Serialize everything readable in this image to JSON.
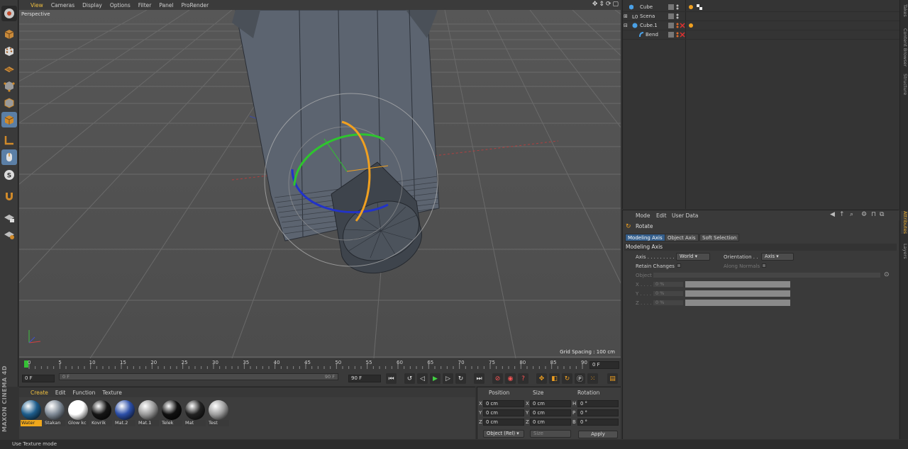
{
  "viewport": {
    "menu": [
      "View",
      "Cameras",
      "Display",
      "Options",
      "Filter",
      "Panel",
      "ProRender"
    ],
    "active_menu": "View",
    "camera_label": "Perspective",
    "grid_spacing": "Grid Spacing : 100 cm",
    "nav_icons": [
      "move-view-icon",
      "zoom-view-icon",
      "rotate-view-icon",
      "maximize-view-icon"
    ]
  },
  "timeline": {
    "ticks": [
      "0",
      "5",
      "10",
      "15",
      "20",
      "25",
      "30",
      "35",
      "40",
      "45",
      "50",
      "55",
      "60",
      "65",
      "70",
      "75",
      "80",
      "85",
      "90"
    ],
    "current_frame": "0 F",
    "start_frame": "0 F",
    "scrub_start": "0 F",
    "scrub_end": "90 F",
    "end_frame": "90 F"
  },
  "materials": {
    "menu": [
      "Create",
      "Edit",
      "Function",
      "Texture"
    ],
    "active_menu": "Create",
    "items": [
      {
        "name": "Water",
        "color": "#1d5d8c",
        "selected": true
      },
      {
        "name": "Stakan",
        "color": "#7f8a96",
        "selected": false
      },
      {
        "name": "Glow kc",
        "color": "#ffffff",
        "selected": false
      },
      {
        "name": "Kovrik",
        "color": "#151515",
        "selected": false
      },
      {
        "name": "Mat.2",
        "color": "#2c4fa8",
        "selected": false
      },
      {
        "name": "Mat.1",
        "color": "#9a9a9a",
        "selected": false
      },
      {
        "name": "Telek",
        "color": "#101010",
        "selected": false
      },
      {
        "name": "Mat",
        "color": "#222222",
        "selected": false
      },
      {
        "name": "Test",
        "color": "#a0a0a0",
        "selected": false
      }
    ]
  },
  "brand": "MAXON CINEMA 4D",
  "coords": {
    "headers": [
      "Position",
      "Size",
      "Rotation"
    ],
    "rows": [
      {
        "axis": "X",
        "pos": "0 cm",
        "size_axis": "X",
        "size": "0 cm",
        "rot_axis": "H",
        "rot": "0 °"
      },
      {
        "axis": "Y",
        "pos": "0 cm",
        "size_axis": "Y",
        "size": "0 cm",
        "rot_axis": "P",
        "rot": "0 °"
      },
      {
        "axis": "Z",
        "pos": "0 cm",
        "size_axis": "Z",
        "size": "0 cm",
        "rot_axis": "B",
        "rot": "0 °"
      }
    ],
    "mode": "Object (Rel)",
    "size_mode": "Size",
    "apply": "Apply"
  },
  "status": "Use Texture mode",
  "objects": [
    {
      "name": "Cube",
      "indent": 1
    },
    {
      "name": "Scena",
      "indent": 0
    },
    {
      "name": "Cube.1",
      "indent": 0
    },
    {
      "name": "Bend",
      "indent": 2
    }
  ],
  "right_tabs": [
    "Takes",
    "Content Browser",
    "Structure",
    "Attributes",
    "Layers"
  ],
  "attributes": {
    "menu": [
      "Mode",
      "Edit",
      "User Data"
    ],
    "tool": "Rotate",
    "tabs": [
      "Modeling Axis",
      "Object Axis",
      "Soft Selection"
    ],
    "section": "Modeling Axis",
    "axis_label": "Axis . . . . . . . . . .",
    "axis_value": "World",
    "orientation_label": "Orientation . .",
    "orientation_value": "Axis",
    "retain_label": "Retain Changes",
    "along_label": "Along Normals",
    "object_label": "Object",
    "x_label": "X . . . .",
    "y_label": "Y . . . .",
    "z_label": "Z . . . .",
    "x_value": "0 %",
    "y_value": "0 %",
    "z_value": "0 %"
  }
}
